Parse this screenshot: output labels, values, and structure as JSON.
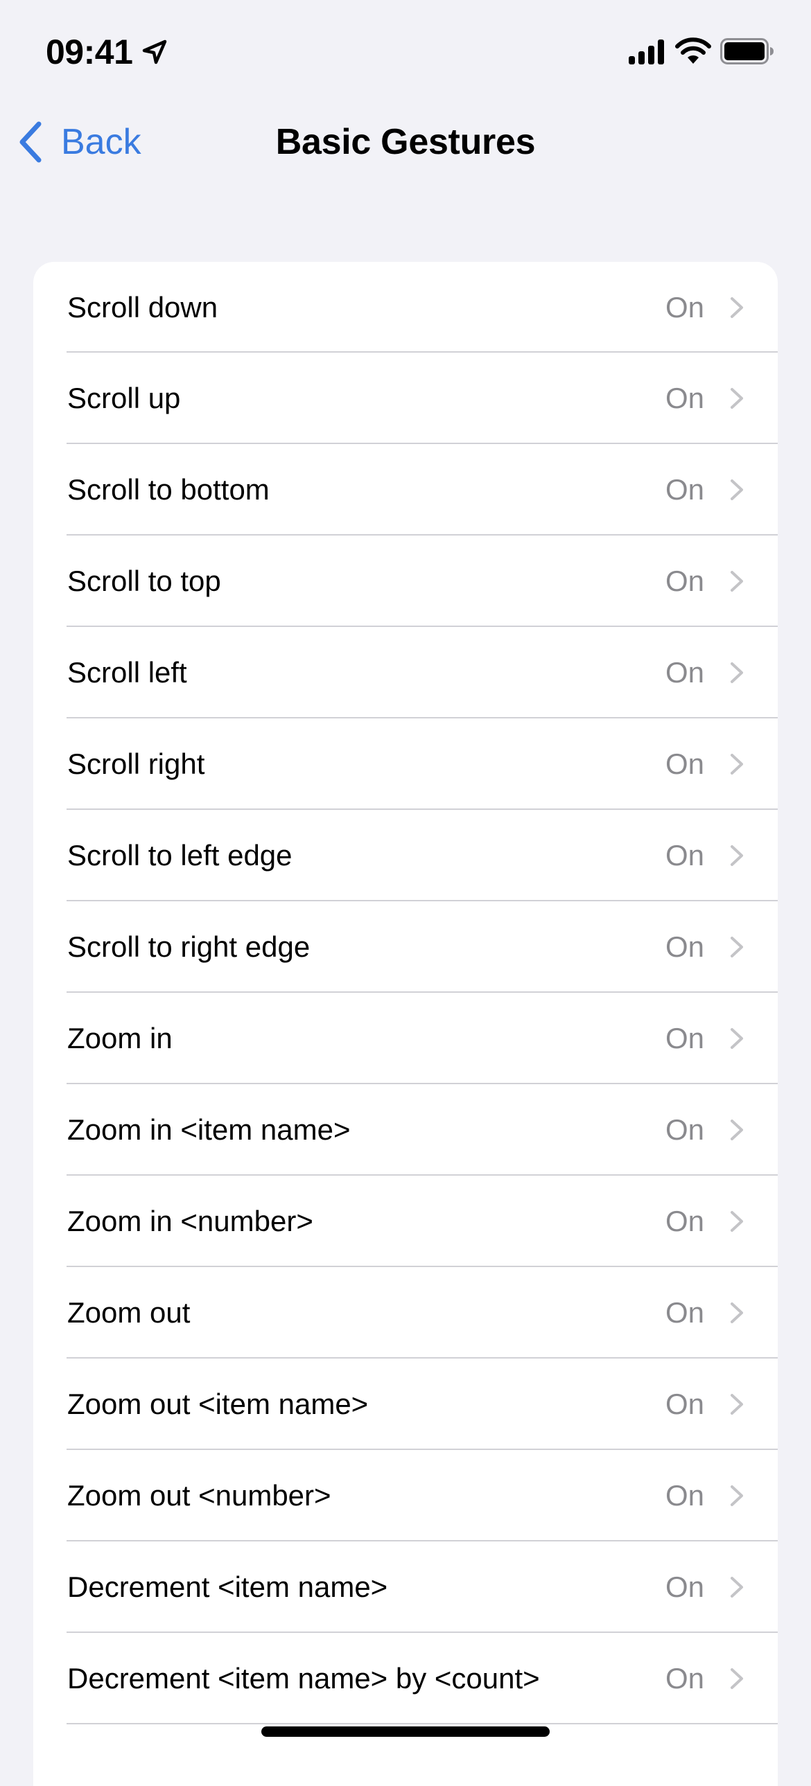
{
  "status_bar": {
    "time": "09:41",
    "icons": [
      "location-arrow-icon",
      "cellular-signal-icon",
      "wifi-icon",
      "battery-icon"
    ]
  },
  "nav": {
    "back_label": "Back",
    "title": "Basic Gestures"
  },
  "colors": {
    "accent": "#3a7be0",
    "background": "#f2f2f7",
    "value_text": "#8a8a8e",
    "chevron": "#c4c4c7",
    "separator": "#d1d1d6"
  },
  "rows": [
    {
      "label": "Scroll down",
      "value": "On"
    },
    {
      "label": "Scroll up",
      "value": "On"
    },
    {
      "label": "Scroll to bottom",
      "value": "On"
    },
    {
      "label": "Scroll to top",
      "value": "On"
    },
    {
      "label": "Scroll left",
      "value": "On"
    },
    {
      "label": "Scroll right",
      "value": "On"
    },
    {
      "label": "Scroll to left edge",
      "value": "On"
    },
    {
      "label": "Scroll to right edge",
      "value": "On"
    },
    {
      "label": "Zoom in",
      "value": "On"
    },
    {
      "label": "Zoom in <item name>",
      "value": "On"
    },
    {
      "label": "Zoom in <number>",
      "value": "On"
    },
    {
      "label": "Zoom out",
      "value": "On"
    },
    {
      "label": "Zoom out <item name>",
      "value": "On"
    },
    {
      "label": "Zoom out <number>",
      "value": "On"
    },
    {
      "label": "Decrement <item name>",
      "value": "On"
    },
    {
      "label": "Decrement <item name> by <count>",
      "value": "On"
    }
  ]
}
